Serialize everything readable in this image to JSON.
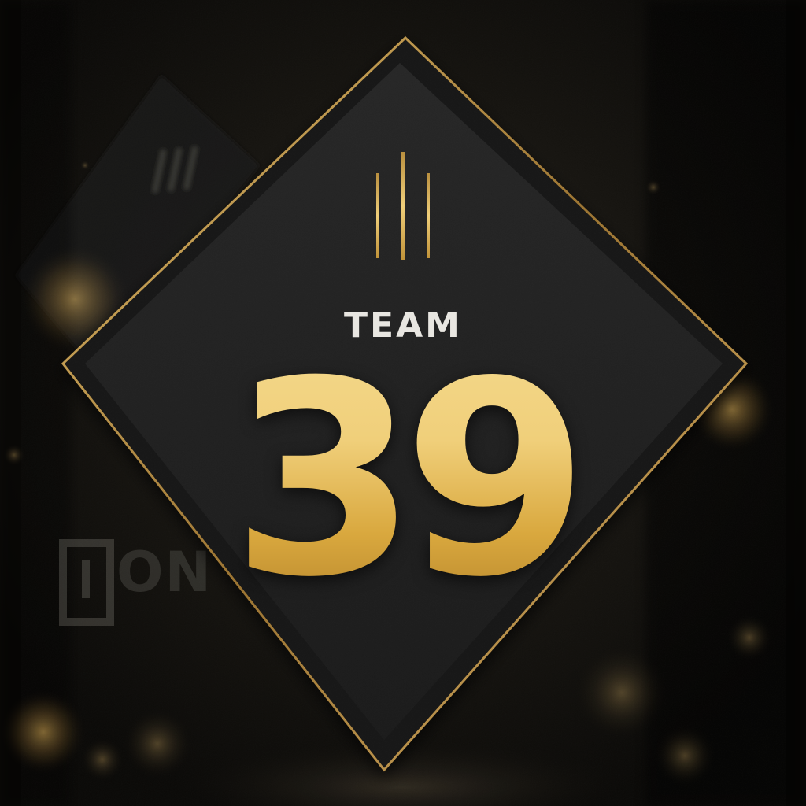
{
  "poster": {
    "label": "TEAM",
    "number": "39",
    "background_brand_fragment": "ON"
  },
  "colors": {
    "gold_light": "#f4d88a",
    "gold_dark": "#b7862c",
    "diamond_fill": "#1e1e1e",
    "border_gold": "#b58a3a",
    "label_white": "#e8e6e1"
  },
  "icons": {
    "top_mark": "three-vertical-lines-icon",
    "background_logo": "brand-logo-icon"
  }
}
